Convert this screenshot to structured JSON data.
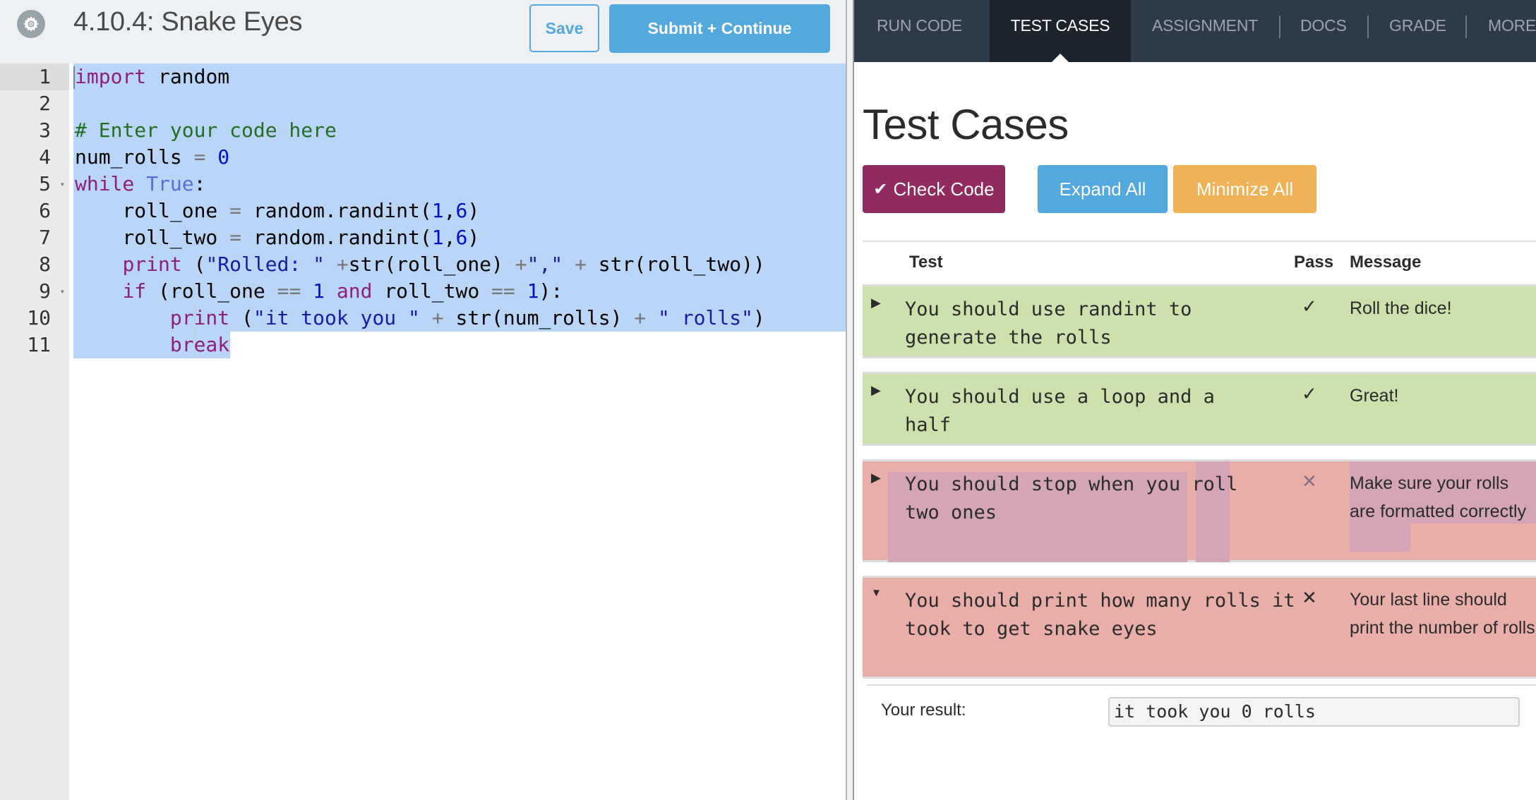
{
  "header": {
    "title": "4.10.4: Snake Eyes",
    "settings_icon": "gear-icon",
    "save_label": "Save",
    "submit_label": "Submit + Continue"
  },
  "editor": {
    "line_numbers": [
      "1",
      "2",
      "3",
      "4",
      "5",
      "6",
      "7",
      "8",
      "9",
      "10",
      "11"
    ],
    "fold_markers": {
      "5": "▾",
      "9": "▾"
    },
    "lines": [
      "import random",
      "",
      "# Enter your code here",
      "num_rolls = 0",
      "while True:",
      "    roll_one = random.randint(1,6)",
      "    roll_two = random.randint(1,6)",
      "    print (\"Rolled: \" +str(roll_one) +\",\" + str(roll_two))",
      "    if (roll_one == 1 and roll_two == 1):",
      "        print (\"it took you \" + str(num_rolls) + \" rolls\")",
      "        break"
    ]
  },
  "nav": {
    "tabs": [
      {
        "label": "RUN CODE",
        "active": false
      },
      {
        "label": "TEST CASES",
        "active": true
      },
      {
        "label": "ASSIGNMENT",
        "active": false
      },
      {
        "label": "DOCS",
        "active": false
      },
      {
        "label": "GRADE",
        "active": false
      },
      {
        "label": "MORE",
        "active": false
      }
    ]
  },
  "test_cases": {
    "heading": "Test Cases",
    "check_code_label": "Check Code",
    "expand_all_label": "Expand All",
    "minimize_all_label": "Minimize All",
    "columns": {
      "test": "Test",
      "pass": "Pass",
      "message": "Message"
    },
    "rows": [
      {
        "test": "You should use randint to generate the rolls",
        "pass": "✓",
        "passed": true,
        "message": "Roll the dice!",
        "expanded": false
      },
      {
        "test": "You should use a loop and a half",
        "pass": "✓",
        "passed": true,
        "message": "Great!",
        "expanded": false
      },
      {
        "test": "You should stop when you roll two ones",
        "pass": "✕",
        "passed": false,
        "message": "Make sure your rolls are formatted correctly",
        "expanded": false
      },
      {
        "test": "You should print how many rolls it took to get snake eyes",
        "pass": "✕",
        "passed": false,
        "message": "Your last line should print the number of rolls",
        "expanded": true
      }
    ],
    "result_label": "Your result:",
    "result_value": "it took you 0 rolls"
  },
  "colors": {
    "accent_blue": "#53a9dd",
    "check_code_purple": "#912a5e",
    "minimize_orange": "#f0b256",
    "pass_green": "#cde1ad",
    "fail_red": "#e8aea8",
    "nav_bg": "#2d3a4a",
    "nav_active": "#1e242d",
    "selection": "#b9d5f8"
  }
}
